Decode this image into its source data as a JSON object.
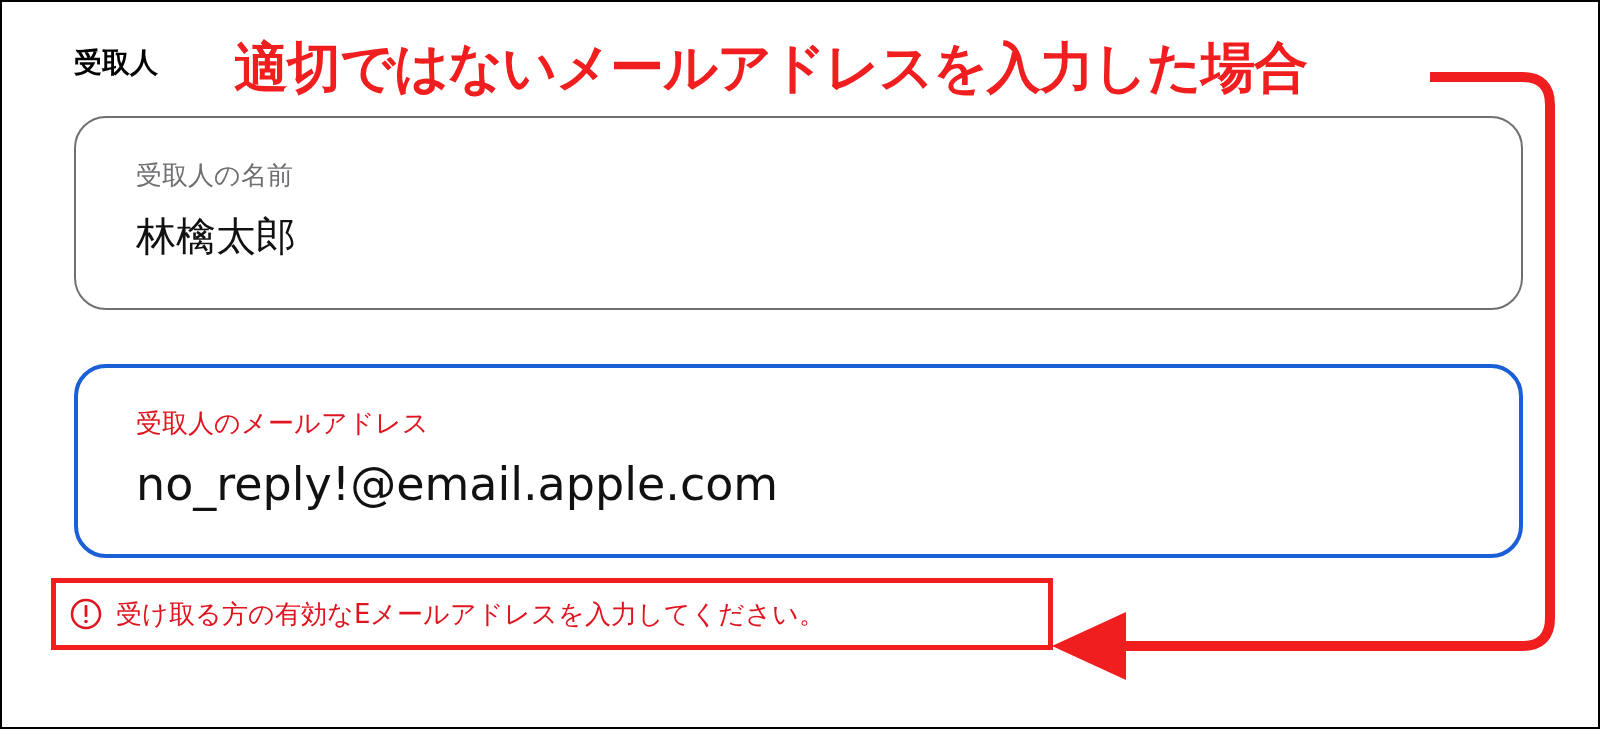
{
  "section_title": "受取人",
  "annotation": {
    "text": "適切ではないメールアドレスを入力した場合"
  },
  "fields": [
    {
      "label": "受取人の名前",
      "value": "林檎太郎",
      "focused": false,
      "invalid": false
    },
    {
      "label": "受取人のメールアドレス",
      "value": "no_reply!@email.apple.com",
      "focused": true,
      "invalid": true
    }
  ],
  "error": {
    "text": "受け取る方の有効なEメールアドレスを入力してください。"
  }
}
